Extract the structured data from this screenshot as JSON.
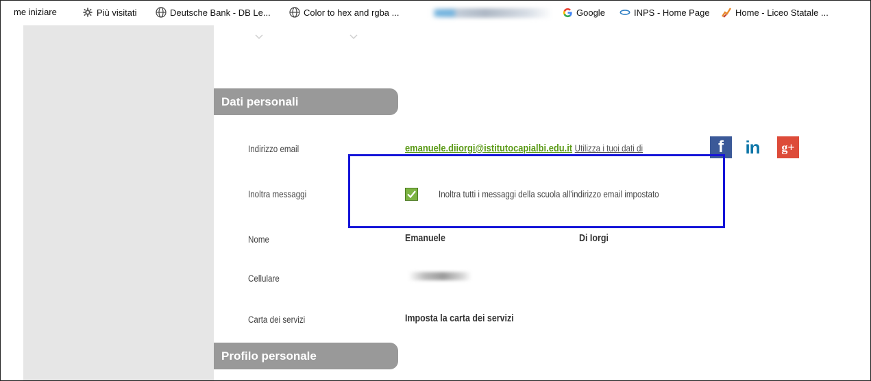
{
  "bookmarks": {
    "items": [
      {
        "label": "me iniziare",
        "icon": "none"
      },
      {
        "label": "Più visitati",
        "icon": "gear-icon"
      },
      {
        "label": "Deutsche Bank - DB Le...",
        "icon": "globe-icon"
      },
      {
        "label": "Color to hex and rgba ...",
        "icon": "globe-icon"
      },
      {
        "label": "Google",
        "icon": "google-icon"
      },
      {
        "label": "INPS - Home Page",
        "icon": "inps-icon"
      },
      {
        "label": "Home - Liceo Statale ...",
        "icon": "liceo-icon"
      }
    ]
  },
  "sections": {
    "personal": "Dati personali",
    "profile": "Profilo personale"
  },
  "rows": {
    "email_label": "Indirizzo email",
    "email_value": "emanuele.diiorgi@istitutocapialbi.edu.it",
    "email_note": "Utilizza i tuoi dati di",
    "forward_label": "Inoltra messaggi",
    "forward_checked": true,
    "forward_text": "Inoltra tutti i messaggi della scuola all'indirizzo email impostato",
    "name_label": "Nome",
    "first_name": "Emanuele",
    "last_name": "Di Iorgi",
    "phone_label": "Cellulare",
    "services_label": "Carta dei servizi",
    "services_link": "Imposta la carta dei servizi"
  },
  "social": {
    "facebook": "f",
    "linkedin": "in",
    "googleplus": "g+",
    "colors": {
      "facebook": "#3b5998",
      "linkedin": "#0e76a8",
      "googleplus": "#dd4b39"
    }
  },
  "colors": {
    "section_bg": "#999999",
    "sidebar_bg": "#e6e6e6",
    "email_link": "#5a9a16",
    "checkbox": "#7cb342",
    "highlight": "#1515d8"
  }
}
